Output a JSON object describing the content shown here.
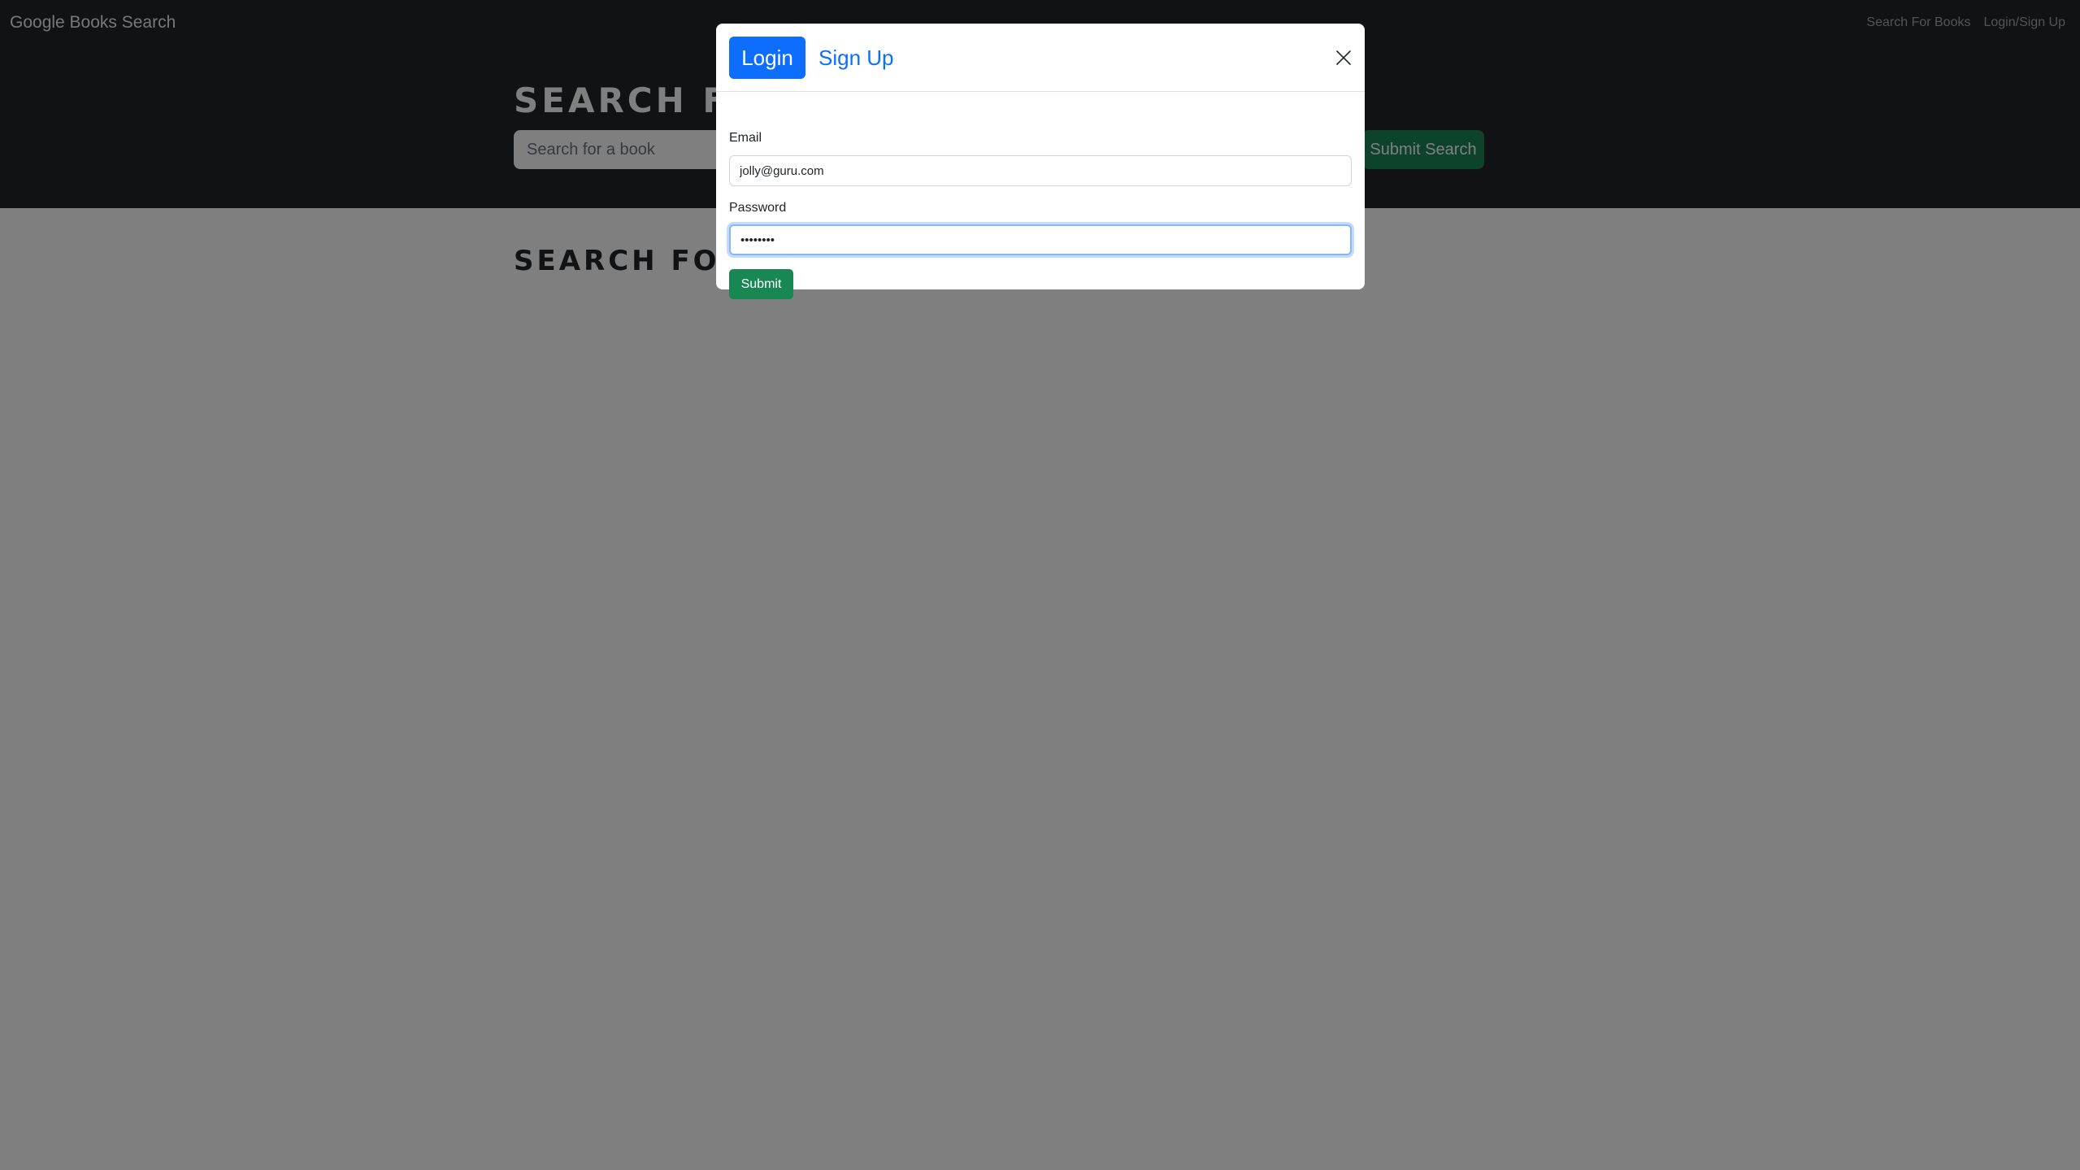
{
  "navbar": {
    "brand": "Google Books Search",
    "links": [
      "Search For Books",
      "Login/Sign Up"
    ]
  },
  "hero": {
    "title": "SEARCH FOR BOOKS!",
    "search_placeholder": "Search for a book",
    "search_button": "Submit Search"
  },
  "results": {
    "heading": "SEARCH FOR A BOOK TO BEGIN"
  },
  "modal": {
    "tabs": [
      "Login",
      "Sign Up"
    ],
    "active_tab": "Login",
    "email_label": "Email",
    "email_value": "jolly@guru.com",
    "password_label": "Password",
    "password_value": "password",
    "submit_label": "Submit",
    "close_icon": "close-icon"
  },
  "colors": {
    "navbar_bg": "#212529",
    "primary": "#0d6efd",
    "success": "#198754",
    "backdrop": "rgba(0,0,0,0.5)"
  }
}
